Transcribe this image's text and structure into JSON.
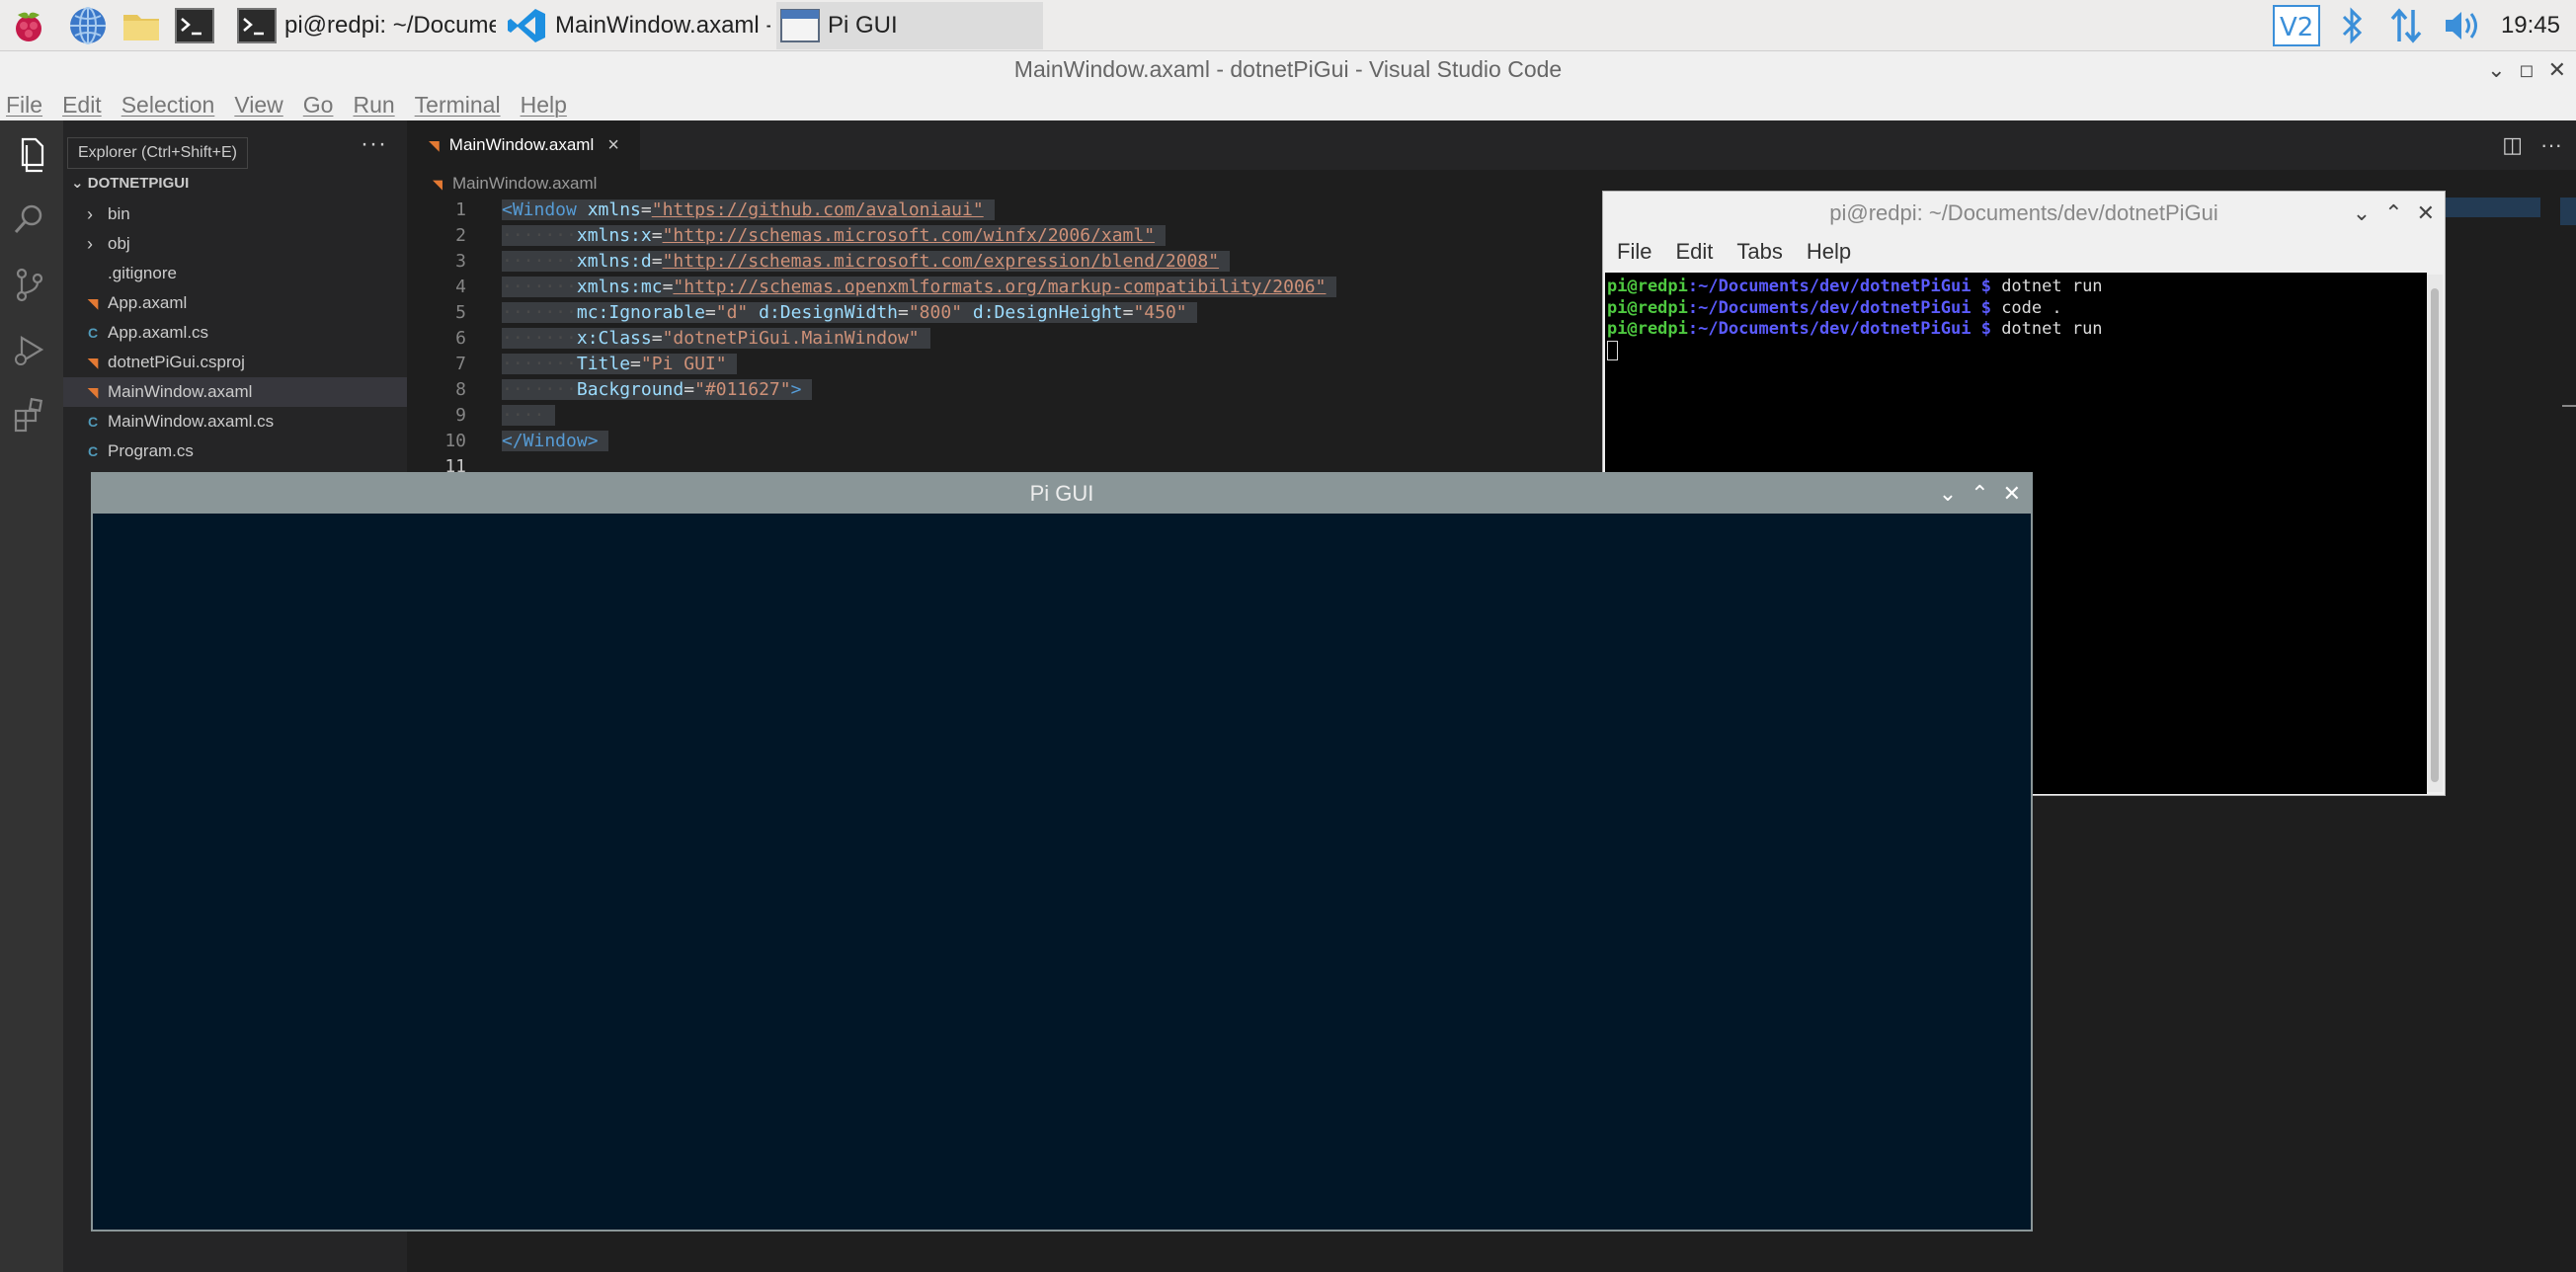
{
  "taskbar": {
    "tasks": [
      {
        "label": "pi@redpi: ~/Docume...",
        "icon": "terminal-icon"
      },
      {
        "label": "MainWindow.axaml -...",
        "icon": "vscode-icon"
      },
      {
        "label": "Pi GUI",
        "icon": "window-icon"
      }
    ],
    "clock": "19:45",
    "tray_icons": [
      "vnc-icon",
      "bluetooth-icon",
      "network-icon",
      "volume-icon"
    ]
  },
  "vscode": {
    "title": "MainWindow.axaml - dotnetPiGui - Visual Studio Code",
    "menu": [
      "File",
      "Edit",
      "Selection",
      "View",
      "Go",
      "Run",
      "Terminal",
      "Help"
    ],
    "tooltip": "Explorer (Ctrl+Shift+E)",
    "explorer": {
      "project": "DOTNETPIGUI",
      "items": [
        {
          "label": "bin",
          "kind": "folder"
        },
        {
          "label": "obj",
          "kind": "folder"
        },
        {
          "label": ".gitignore",
          "kind": "file"
        },
        {
          "label": "App.axaml",
          "kind": "axaml"
        },
        {
          "label": "App.axaml.cs",
          "kind": "cs"
        },
        {
          "label": "dotnetPiGui.csproj",
          "kind": "axaml"
        },
        {
          "label": "MainWindow.axaml",
          "kind": "axaml",
          "selected": true
        },
        {
          "label": "MainWindow.axaml.cs",
          "kind": "cs"
        },
        {
          "label": "Program.cs",
          "kind": "cs"
        }
      ]
    },
    "tab_label": "MainWindow.axaml",
    "breadcrumb": "MainWindow.axaml",
    "line_numbers": [
      "1",
      "2",
      "3",
      "4",
      "5",
      "6",
      "7",
      "8",
      "9",
      "10",
      "11"
    ],
    "code": {
      "l1": {
        "tag": "<Window",
        "attr": "xmlns",
        "eq": "=",
        "val": "\"https://github.com/avaloniaui\""
      },
      "l2": {
        "ws": "·······",
        "attr": "xmlns:x",
        "eq": "=",
        "val": "\"http://schemas.microsoft.com/winfx/2006/xaml\""
      },
      "l3": {
        "ws": "·······",
        "attr": "xmlns:d",
        "eq": "=",
        "val": "\"http://schemas.microsoft.com/expression/blend/2008\""
      },
      "l4": {
        "ws": "·······",
        "attr": "xmlns:mc",
        "eq": "=",
        "val": "\"http://schemas.openxmlformats.org/markup-compatibility/2006\""
      },
      "l5": {
        "ws": "·······",
        "attr1": "mc:Ignorable",
        "val1": "\"d\"",
        "attr2": "d:DesignWidth",
        "val2": "\"800\"",
        "attr3": "d:DesignHeight",
        "val3": "\"450\""
      },
      "l6": {
        "ws": "·······",
        "attr": "x:Class",
        "eq": "=",
        "val": "\"dotnetPiGui.MainWindow\""
      },
      "l7": {
        "ws": "·······",
        "attr": "Title",
        "eq": "=",
        "val": "\"Pi GUI\""
      },
      "l8": {
        "ws": "·······",
        "attr": "Background",
        "eq": "=",
        "val": "\"#011627\"",
        "close": ">"
      },
      "l9": {
        "ws": "····"
      },
      "l10": {
        "tag": "</Window>"
      }
    }
  },
  "terminal": {
    "title": "pi@redpi: ~/Documents/dev/dotnetPiGui",
    "menu": [
      "File",
      "Edit",
      "Tabs",
      "Help"
    ],
    "lines": [
      {
        "user": "pi@redpi",
        "path": ":~/Documents/dev/dotnetPiGui",
        "prompt": " $ ",
        "cmd": "dotnet run"
      },
      {
        "user": "pi@redpi",
        "path": ":~/Documents/dev/dotnetPiGui",
        "prompt": " $ ",
        "cmd": "code ."
      },
      {
        "user": "pi@redpi",
        "path": ":~/Documents/dev/dotnetPiGui",
        "prompt": " $ ",
        "cmd": "dotnet run"
      }
    ]
  },
  "pigui": {
    "title": "Pi GUI",
    "background": "#011627"
  },
  "colors": {
    "vscode_bg": "#1e1e1e",
    "sidebar_bg": "#252526",
    "activity_bg": "#333333",
    "pigui_bg": "#011627",
    "titlebar_gray": "#8a9698"
  }
}
